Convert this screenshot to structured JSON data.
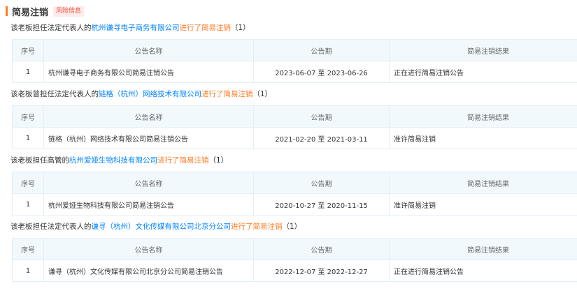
{
  "section": {
    "title": "简易注销",
    "badge": "风险信息"
  },
  "table_headers": {
    "index": "序号",
    "name": "公告名称",
    "period": "公告期",
    "result": "简易注销结果"
  },
  "groups": [
    {
      "prefix": "该老板担任法定代表人的",
      "company": "杭州谦寻电子商务有限公司",
      "action": "进行了简易注销",
      "count": "（1）",
      "rows": [
        {
          "index": "1",
          "name": "杭州谦寻电子商务有限公司简易注销公告",
          "period": "2023-06-07 至 2023-06-26",
          "result": "正在进行简易注销公告"
        }
      ]
    },
    {
      "prefix": "该老板曾担任法定代表人的",
      "company": "链格（杭州）网络技术有限公司",
      "action": "进行了简易注销",
      "count": "（1）",
      "rows": [
        {
          "index": "1",
          "name": "链格（杭州）网络技术有限公司简易注销公告",
          "period": "2021-02-20 至 2021-03-11",
          "result": "准许简易注销"
        }
      ]
    },
    {
      "prefix": "该老板担任高管的",
      "company": "杭州爱娅生物科技有限公司",
      "action": "进行了简易注销",
      "count": "（1）",
      "rows": [
        {
          "index": "1",
          "name": "杭州爱娅生物科技有限公司简易注销公告",
          "period": "2020-10-27 至 2020-11-15",
          "result": "准许简易注销"
        }
      ]
    },
    {
      "prefix": "该老板担任法定代表人的",
      "company": "谦寻（杭州）文化传媒有限公司北京分公司",
      "action": "进行了简易注销",
      "count": "（1）",
      "rows": [
        {
          "index": "1",
          "name": "谦寻（杭州）文化传媒有限公司北京分公司简易注销公告",
          "period": "2022-12-07 至 2022-12-27",
          "result": "正在进行简易注销公告"
        }
      ]
    }
  ]
}
